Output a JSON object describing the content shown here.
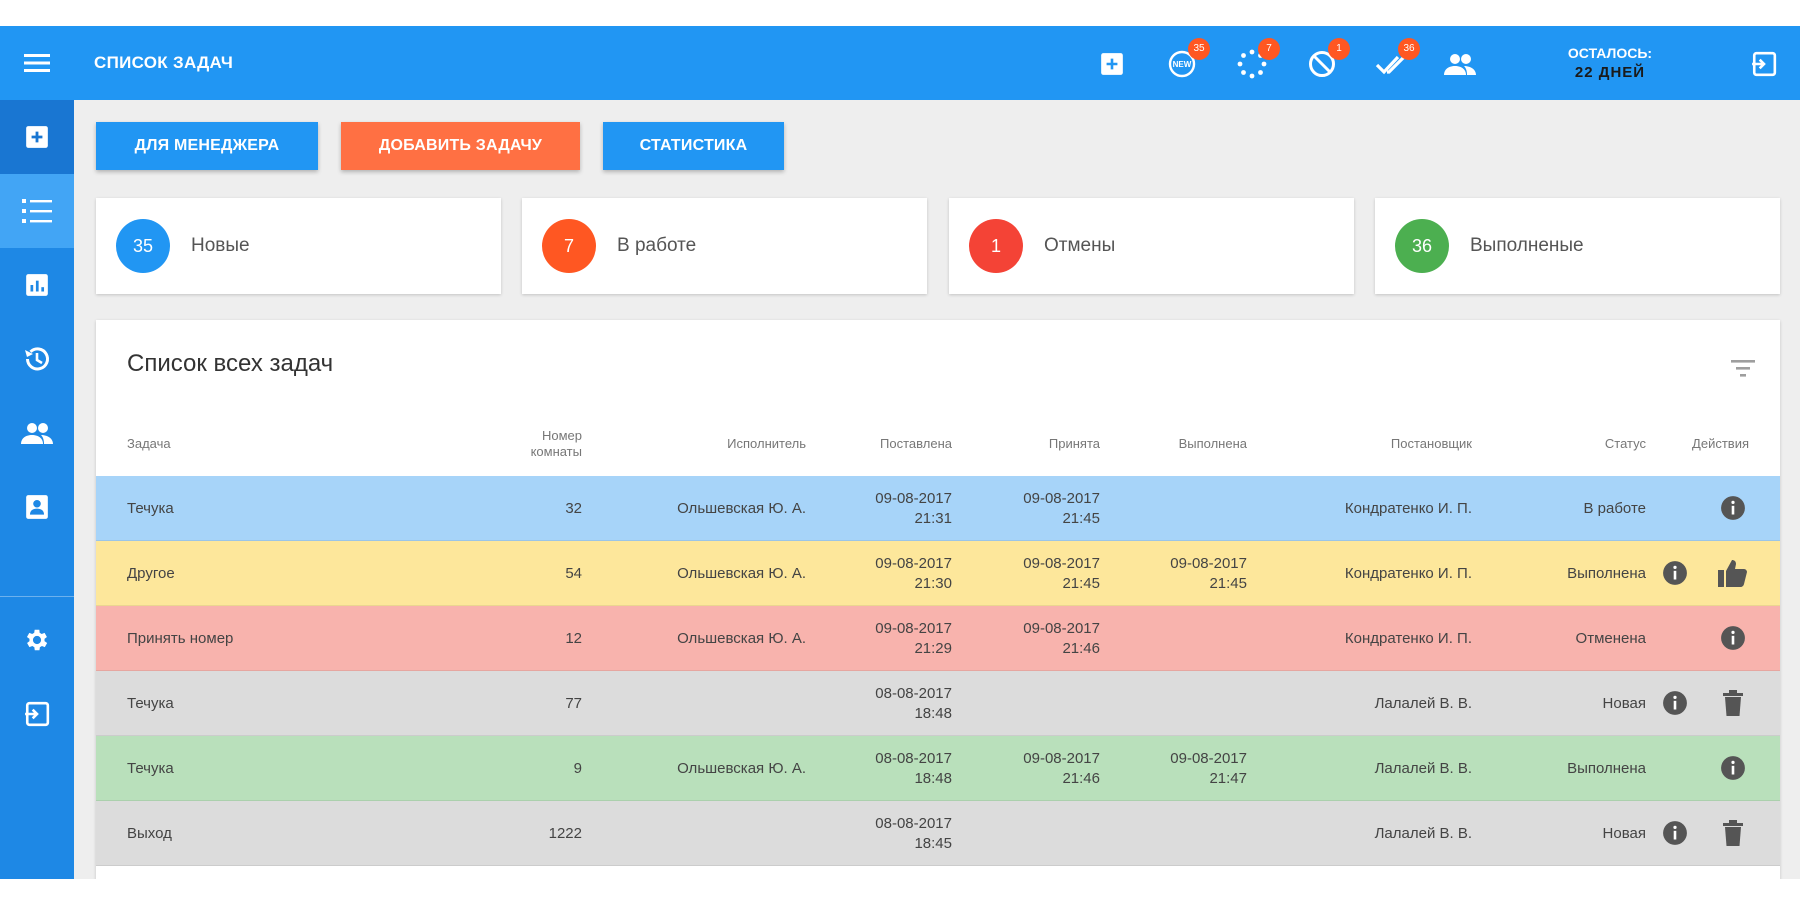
{
  "header": {
    "title": "СПИСОК ЗАДАЧ",
    "badges": {
      "new": "35",
      "in_progress": "7",
      "canceled": "1",
      "done": "36"
    },
    "remaining_label": "ОСТАЛОСЬ:",
    "remaining_value": "22 ДНЕЙ",
    "icons": [
      "menu-icon",
      "add-box-icon",
      "new-icon",
      "loading-icon",
      "block-icon",
      "done-all-icon",
      "people-icon",
      "exit-icon"
    ]
  },
  "sidebar": {
    "items": [
      {
        "icon": "add-box-icon"
      },
      {
        "icon": "task-list-icon"
      },
      {
        "icon": "chart-icon"
      },
      {
        "icon": "history-icon"
      },
      {
        "icon": "people-icon"
      },
      {
        "icon": "contact-card-icon"
      },
      {
        "icon": "gear-icon"
      },
      {
        "icon": "exit-icon"
      }
    ]
  },
  "toolbar": {
    "manager_label": "ДЛЯ МЕНЕДЖЕРА",
    "add_task_label": "ДОБАВИТЬ ЗАДАЧУ",
    "stats_label": "СТАТИСТИКА"
  },
  "stats": [
    {
      "count": "35",
      "label": "Новые",
      "color": "#2196f3"
    },
    {
      "count": "7",
      "label": "В работе",
      "color": "#ff5722"
    },
    {
      "count": "1",
      "label": "Отмены",
      "color": "#f44336"
    },
    {
      "count": "36",
      "label": "Выполненые",
      "color": "#4caf50"
    }
  ],
  "table": {
    "title": "Список всех задач",
    "columns": {
      "task": "Задача",
      "room_line1": "Номер",
      "room_line2": "комнаты",
      "executor": "Исполнитель",
      "created": "Поставлена",
      "accepted": "Принята",
      "completed": "Выполнена",
      "author": "Постановщик",
      "status": "Статус",
      "actions": "Действия"
    },
    "rows": [
      {
        "task": "Течука",
        "room": "32",
        "executor": "Ольшевская Ю. А.",
        "created_date": "09-08-2017",
        "created_time": "21:31",
        "accepted_date": "09-08-2017",
        "accepted_time": "21:45",
        "completed_date": "",
        "completed_time": "",
        "author": "Кондратенко И. П.",
        "status": "В работе",
        "bg": "#a7d4f9"
      },
      {
        "task": "Другое",
        "room": "54",
        "executor": "Ольшевская Ю. А.",
        "created_date": "09-08-2017",
        "created_time": "21:30",
        "accepted_date": "09-08-2017",
        "accepted_time": "21:45",
        "completed_date": "09-08-2017",
        "completed_time": "21:45",
        "author": "Кондратенко И. П.",
        "status": "Выполнена",
        "bg": "#fde79b"
      },
      {
        "task": "Принять номер",
        "room": "12",
        "executor": "Ольшевская Ю. А.",
        "created_date": "09-08-2017",
        "created_time": "21:29",
        "accepted_date": "09-08-2017",
        "accepted_time": "21:46",
        "completed_date": "",
        "completed_time": "",
        "author": "Кондратенко И. П.",
        "status": "Отменена",
        "bg": "#f8b3ad"
      },
      {
        "task": "Течука",
        "room": "77",
        "executor": "",
        "created_date": "08-08-2017",
        "created_time": "18:48",
        "accepted_date": "",
        "accepted_time": "",
        "completed_date": "",
        "completed_time": "",
        "author": "Лалалей В. В.",
        "status": "Новая",
        "bg": "#dcdcdc"
      },
      {
        "task": "Течука",
        "room": "9",
        "executor": "Ольшевская Ю. А.",
        "created_date": "08-08-2017",
        "created_time": "18:48",
        "accepted_date": "09-08-2017",
        "accepted_time": "21:46",
        "completed_date": "09-08-2017",
        "completed_time": "21:47",
        "author": "Лалалей В. В.",
        "status": "Выполнена",
        "bg": "#b9e0bb"
      },
      {
        "task": "Выход",
        "room": "1222",
        "executor": "",
        "created_date": "08-08-2017",
        "created_time": "18:45",
        "accepted_date": "",
        "accepted_time": "",
        "completed_date": "",
        "completed_time": "",
        "author": "Лалалей В. В.",
        "status": "Новая",
        "bg": "#dcdcdc"
      }
    ]
  }
}
